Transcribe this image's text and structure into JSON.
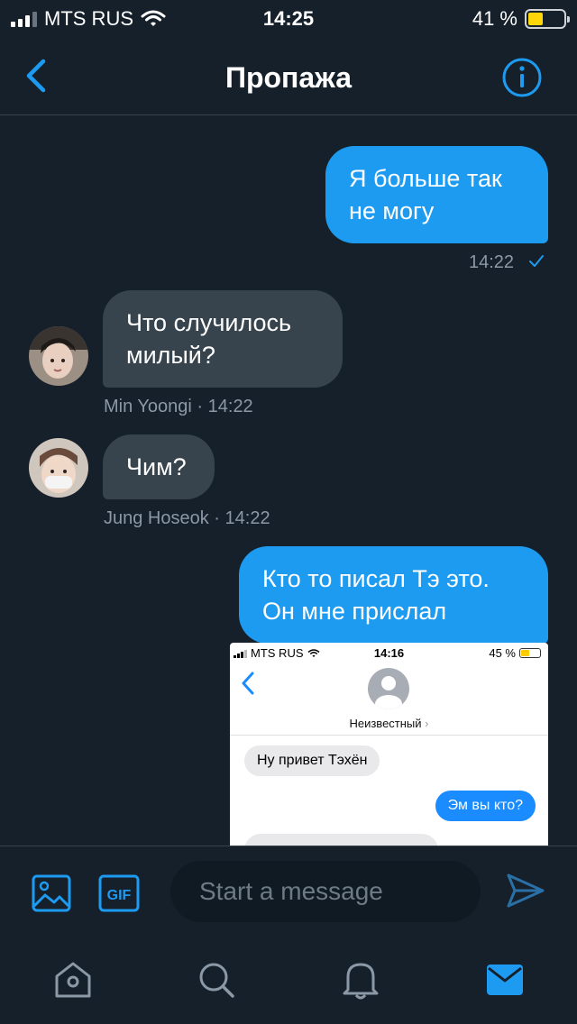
{
  "status_bar": {
    "carrier": "MTS RUS",
    "time": "14:25",
    "battery_percent": "41 %",
    "battery_level": 0.41
  },
  "header": {
    "title": "Пропажа"
  },
  "messages": [
    {
      "direction": "out",
      "text_lines": [
        "Я больше так",
        "не могу"
      ],
      "time": "14:22"
    },
    {
      "direction": "in",
      "text_lines": [
        "Что случилось",
        "милый?"
      ],
      "sender_time": "Min Yoongi · 14:22"
    },
    {
      "direction": "in",
      "text_lines": [
        "Чим?"
      ],
      "sender_time": "Jung Hoseok · 14:22"
    },
    {
      "direction": "out",
      "text_lines": [
        "Кто то писал Тэ это.",
        "Он мне прислал"
      ]
    }
  ],
  "embedded_screenshot": {
    "carrier": "MTS RUS",
    "time": "14:16",
    "battery_percent": "45 %",
    "battery_level": 0.45,
    "contact_name": "Неизвестный",
    "incoming_message": "Ну привет Тэхён",
    "outgoing_message": "Эм вы кто?"
  },
  "composer": {
    "placeholder": "Start a message",
    "gif_label": "GIF"
  },
  "colors": {
    "background": "#15202b",
    "accent": "#1d9bf0",
    "incoming_bubble": "#38444d"
  },
  "icons": [
    "back-icon",
    "info-icon",
    "image-icon",
    "gif-icon",
    "send-icon",
    "home-icon",
    "search-icon",
    "bell-icon",
    "mail-icon"
  ]
}
